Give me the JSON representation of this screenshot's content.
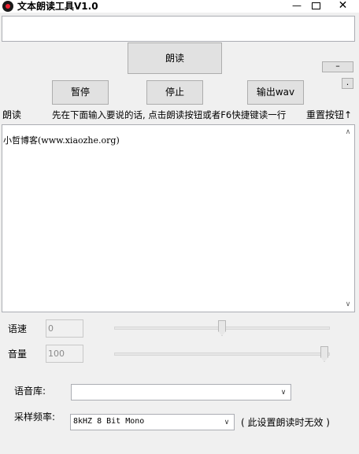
{
  "window": {
    "title": "文本朗读工具V1.0",
    "min_glyph": "—",
    "close_glyph": "✕",
    "icon": "app-disc-icon"
  },
  "toolbar": {
    "read_label": "朗读",
    "dash_label": "–",
    "dot_label": ".",
    "pause_label": "暂停",
    "stop_label": "停止",
    "export_label": "输出wav"
  },
  "labels": {
    "read": "朗读",
    "hint": "先在下面输入要说的话, 点击朗读按钮或者F6快捷键读一行",
    "reset": "重置按钮↑"
  },
  "editor": {
    "text": "小哲博客(www.xiaozhe.org)",
    "scroll_up_glyph": "∧",
    "scroll_down_glyph": "∨"
  },
  "speed": {
    "label": "语速",
    "value": "0",
    "slider_fraction": 0.5
  },
  "volume": {
    "label": "音量",
    "value": "100",
    "slider_fraction": 1.0
  },
  "voice_library": {
    "label": "语音库:",
    "value": ""
  },
  "sample_rate": {
    "label": "采样频率:",
    "value": "8kHZ 8 Bit Mono",
    "note": "( 此设置朗读时无效 )"
  },
  "chevron_glyph": "∨"
}
